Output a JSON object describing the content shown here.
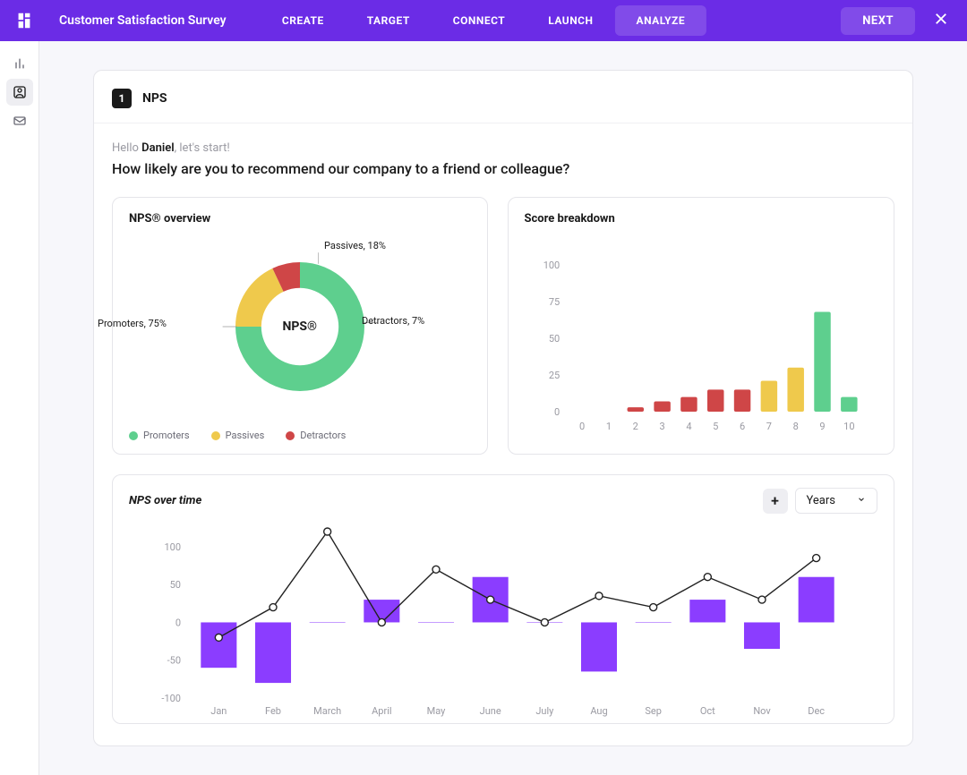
{
  "header": {
    "title": "Customer Satisfaction Survey",
    "tabs": [
      {
        "label": "CREATE"
      },
      {
        "label": "TARGET"
      },
      {
        "label": "CONNECT"
      },
      {
        "label": "LAUNCH"
      },
      {
        "label": "ANALYZE"
      }
    ],
    "next_label": "NEXT"
  },
  "question": {
    "number": "1",
    "type": "NPS",
    "greeting_prefix": "Hello ",
    "greeting_name": "Daniel",
    "greeting_suffix": ", let's start!",
    "text": "How likely are you to recommend our company to a friend or colleague?"
  },
  "overview": {
    "title": "NPS® overview",
    "center_label": "NPS®",
    "segments": {
      "promoters": {
        "label": "Promoters",
        "pct": 75,
        "color": "#5ecf8e",
        "display": "Promoters, 75%"
      },
      "passives": {
        "label": "Passives",
        "pct": 18,
        "color": "#efc94c",
        "display": "Passives, 18%"
      },
      "detractors": {
        "label": "Detractors",
        "pct": 7,
        "color": "#cf4647",
        "display": "Detractors, 7%"
      }
    },
    "legend": [
      "Promoters",
      "Passives",
      "Detractors"
    ]
  },
  "breakdown": {
    "title": "Score breakdown"
  },
  "time": {
    "title": "NPS over time",
    "dropdown_label": "Years"
  },
  "colors": {
    "primary": "#6b2ce6",
    "promoters": "#5ecf8e",
    "passives": "#efc94c",
    "detractors": "#cf4647"
  },
  "chart_data": [
    {
      "type": "pie",
      "title": "NPS® overview",
      "series": [
        {
          "name": "Promoters",
          "value": 75,
          "color": "#5ecf8e"
        },
        {
          "name": "Passives",
          "value": 18,
          "color": "#efc94c"
        },
        {
          "name": "Detractors",
          "value": 7,
          "color": "#cf4647"
        }
      ]
    },
    {
      "type": "bar",
      "title": "Score breakdown",
      "xlabel": "",
      "ylabel": "",
      "ylim": [
        0,
        100
      ],
      "yticks": [
        0,
        25,
        50,
        75,
        100
      ],
      "categories": [
        "0",
        "1",
        "2",
        "3",
        "4",
        "5",
        "6",
        "7",
        "8",
        "9",
        "10"
      ],
      "values": [
        0,
        0,
        3,
        7,
        10,
        15,
        15,
        21,
        30,
        68,
        10
      ],
      "colors": [
        "#cf4647",
        "#cf4647",
        "#cf4647",
        "#cf4647",
        "#cf4647",
        "#cf4647",
        "#cf4647",
        "#efc94c",
        "#efc94c",
        "#5ecf8e",
        "#5ecf8e"
      ]
    },
    {
      "type": "bar",
      "title": "NPS over time",
      "xlabel": "",
      "ylabel": "",
      "ylim": [
        -100,
        120
      ],
      "yticks": [
        -100,
        -50,
        0,
        50,
        100
      ],
      "categories": [
        "Jan",
        "Feb",
        "March",
        "April",
        "May",
        "June",
        "July",
        "Aug",
        "Sep",
        "Oct",
        "Nov",
        "Dec"
      ],
      "series": [
        {
          "name": "bars",
          "values": [
            -60,
            -80,
            0,
            30,
            0,
            60,
            0,
            -65,
            0,
            30,
            -35,
            60
          ],
          "color": "#8b3dff"
        },
        {
          "name": "line",
          "values": [
            -20,
            20,
            120,
            0,
            70,
            30,
            0,
            35,
            20,
            60,
            30,
            85
          ],
          "color": "#222"
        }
      ]
    }
  ]
}
